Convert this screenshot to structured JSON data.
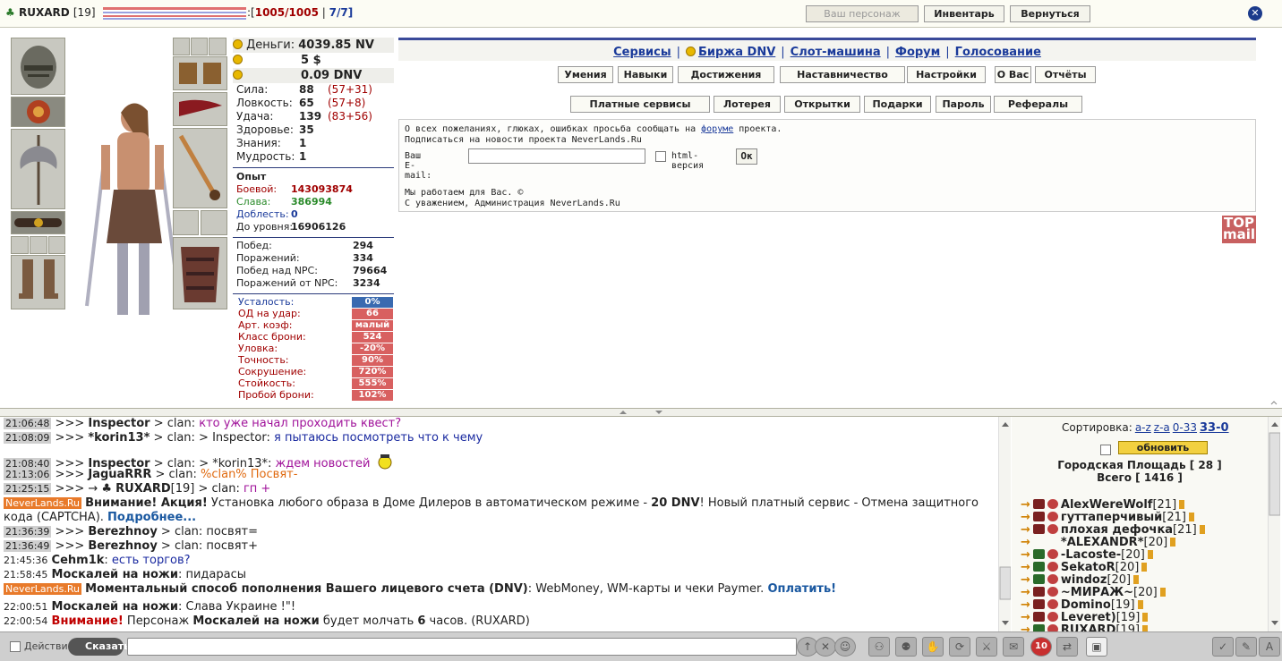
{
  "header": {
    "nick": "RUXARD",
    "level": "[19]",
    "hp_prefix": ":[",
    "hp": "1005/1005",
    "sep": "|",
    "mana": "7/7]",
    "buttons": [
      {
        "label": "Ваш персонаж",
        "disabled": true
      },
      {
        "label": "Инвентарь",
        "disabled": false
      },
      {
        "label": "Вернуться",
        "disabled": false
      }
    ],
    "close": "✕"
  },
  "money": {
    "label": "Деньги:",
    "nv": "4039.85 NV",
    "usd": "5 $",
    "dnv": "0.09 DNV"
  },
  "stats": [
    {
      "label": "Сила:",
      "value": "88",
      "sub": "(57+31)"
    },
    {
      "label": "Ловкость:",
      "value": "65",
      "sub": "(57+8)"
    },
    {
      "label": "Удача:",
      "value": "139",
      "sub": "(83+56)"
    },
    {
      "label": "Здоровье:",
      "value": "35",
      "sub": ""
    },
    {
      "label": "Знания:",
      "value": "1",
      "sub": ""
    },
    {
      "label": "Мудрость:",
      "value": "1",
      "sub": ""
    }
  ],
  "experience": {
    "title": "Опыт",
    "rows": [
      {
        "label": "Боевой:",
        "value": "143093874",
        "color": "#a00000"
      },
      {
        "label": "Слава:",
        "value": "386994",
        "color": "#2a8a2a"
      },
      {
        "label": "Доблесть:",
        "value": "0",
        "color": "#1a3a9a"
      },
      {
        "label": "До уровня:",
        "value": "16906126",
        "color": "#222222"
      }
    ]
  },
  "wins": [
    {
      "label": "Побед:",
      "value": "294"
    },
    {
      "label": "Поражений:",
      "value": "334"
    },
    {
      "label": "Побед над NPC:",
      "value": "79664"
    },
    {
      "label": "Поражений от NPC:",
      "value": "3234"
    }
  ],
  "mods": [
    {
      "label": "Усталость:",
      "value": "0%",
      "blue": true
    },
    {
      "label": "ОД на удар:",
      "value": "66"
    },
    {
      "label": "Арт. коэф:",
      "value": "малый"
    },
    {
      "label": "Класс брони:",
      "value": "524"
    },
    {
      "label": "Уловка:",
      "value": "-20%"
    },
    {
      "label": "Точность:",
      "value": "90%"
    },
    {
      "label": "Сокрушение:",
      "value": "720%"
    },
    {
      "label": "Стойкость:",
      "value": "555%"
    },
    {
      "label": "Пробой брони:",
      "value": "102%"
    }
  ],
  "links": [
    {
      "label": "Сервисы"
    },
    {
      "label": "Биржа DNV"
    },
    {
      "label": "Слот-машина"
    },
    {
      "label": "Форум"
    },
    {
      "label": "Голосование"
    }
  ],
  "link_sep": "|",
  "row1": [
    "Умения",
    "Навыки",
    "Достижения",
    "Наставничество",
    "Настройки",
    "О Вас",
    "Отчёты"
  ],
  "row2": [
    "Платные сервисы",
    "Лотерея",
    "Открытки",
    "Подарки",
    "Пароль",
    "Рефералы"
  ],
  "info": {
    "line1_pre": "О всех пожеланиях, глюках, ошибках просьба сообщать на ",
    "line1_link": "форуме",
    "line1_post": " проекта.",
    "line2": "Подписаться на новости проекта NeverLands.Ru",
    "email_label": "Ваш E-mail:",
    "html_label": "html-версия",
    "ok": "Ок",
    "footer1": "Мы работаем для Вас. ©",
    "footer2": "С уважением, Администрация NeverLands.Ru"
  },
  "topmail": {
    "line1": "TOP",
    "line2": "mail"
  },
  "chat": [
    {
      "ts": "21:06:48",
      "parts": [
        [
          ">>> ",
          ""
        ],
        [
          "Inspector",
          "b"
        ],
        [
          " > clan: ",
          ""
        ],
        [
          "кто уже начал проходить квест?",
          "pink"
        ]
      ]
    },
    {
      "ts": "21:08:09",
      "parts": [
        [
          ">>> ",
          ""
        ],
        [
          "*korin13*",
          "b"
        ],
        [
          " > clan: > Inspector: ",
          ""
        ],
        [
          "я пытаюсь посмотреть что к чему",
          "blue"
        ]
      ]
    },
    {
      "ts": "21:08:40",
      "parts": [
        [
          ">>> ",
          ""
        ],
        [
          "Inspector",
          "b"
        ],
        [
          " > clan: > *korin13*: ",
          ""
        ],
        [
          "ждем новостей",
          "pink"
        ]
      ]
    },
    {
      "ts": "21:13:06",
      "parts": [
        [
          ">>> ",
          ""
        ],
        [
          "JaguaRRR",
          "b"
        ],
        [
          " > clan: ",
          ""
        ],
        [
          "%clan% Посвят-",
          "orange"
        ]
      ]
    },
    {
      "ts": "21:25:15",
      "parts": [
        [
          ">>> → ♣ ",
          ""
        ],
        [
          "RUXARD",
          "b"
        ],
        [
          "[19] ",
          ""
        ],
        [
          " > clan: ",
          ""
        ],
        [
          "гп +",
          "pink"
        ]
      ]
    },
    {
      "nl": "NeverLands.Ru",
      "parts": [
        [
          "Внимание! Акция!",
          "b"
        ],
        [
          " Установка любого образа в Доме Дилеров в автоматическом режиме - ",
          ""
        ],
        [
          "20 DNV",
          "b"
        ],
        [
          "! Новый платный сервис - Отмена защитного кода (CAPTCHA). ",
          ""
        ],
        [
          "Подробнее...",
          "lnk"
        ]
      ]
    },
    {
      "ts": "21:36:39",
      "parts": [
        [
          ">>> ",
          ""
        ],
        [
          "Berezhnoy",
          "b"
        ],
        [
          " > clan: посвят=",
          ""
        ]
      ]
    },
    {
      "ts": "21:36:49",
      "parts": [
        [
          ">>> ",
          ""
        ],
        [
          "Berezhnoy",
          "b"
        ],
        [
          " > clan: посвят+",
          ""
        ]
      ]
    },
    {
      "ts_plain": "21:45:36",
      "parts": [
        [
          "Cehm1k",
          "b"
        ],
        [
          ": ",
          ""
        ],
        [
          "есть торгов?",
          "blue"
        ]
      ]
    },
    {
      "ts_plain": "21:58:45",
      "parts": [
        [
          "Москалей на ножи",
          "b"
        ],
        [
          ": пидарасы",
          ""
        ]
      ]
    },
    {
      "nl": "NeverLands.Ru",
      "parts": [
        [
          "Моментальный способ пополнения Вашего лицевого счета (DNV)",
          "b"
        ],
        [
          ": ",
          ""
        ],
        [
          "WebMoney, WM-карты и чеки Paymer. ",
          ""
        ],
        [
          "Оплатить!",
          "lnk"
        ]
      ]
    },
    {
      "ts_plain": "22:00:51",
      "parts": [
        [
          "Москалей на ножи",
          "b"
        ],
        [
          ": Слава Украине !\"!",
          ""
        ]
      ]
    },
    {
      "ts_plain": "22:00:54",
      "parts": [
        [
          "Внимание!",
          "b red"
        ],
        [
          " Персонаж ",
          ""
        ],
        [
          "Москалей на ножи",
          "b"
        ],
        [
          " будет молчать ",
          ""
        ],
        [
          "6",
          "b"
        ],
        [
          " часов. (RUXARD)",
          ""
        ]
      ]
    }
  ],
  "online": {
    "sort_label": "Сортировка:",
    "sort_opts": [
      "a-z",
      "z-a",
      "0-33",
      "33-0"
    ],
    "refresh": "обновить",
    "location": "Городская Площадь [ 28 ]",
    "total": "Всего [ 1416 ]",
    "users": [
      {
        "name": "AlexWereWolf",
        "lvl": "[21]",
        "clan": "red"
      },
      {
        "name": "гуттаперчивый",
        "lvl": "[21]",
        "clan": "red"
      },
      {
        "name": "плохая дефочка",
        "lvl": "[21]",
        "clan": "red"
      },
      {
        "name": "*ALEXANDR*",
        "lvl": "[20]",
        "clan": "none"
      },
      {
        "name": "-Lacoste-",
        "lvl": "[20]",
        "clan": "green"
      },
      {
        "name": "SekatoR",
        "lvl": "[20]",
        "clan": "green"
      },
      {
        "name": "windoz",
        "lvl": "[20]",
        "clan": "green"
      },
      {
        "name": "~МИРАЖ~",
        "lvl": "[20]",
        "clan": "red"
      },
      {
        "name": "Domino",
        "lvl": "[19]",
        "clan": "red"
      },
      {
        "name": "Leveret)",
        "lvl": "[19]",
        "clan": "red"
      },
      {
        "name": "RUXARD",
        "lvl": "[19]",
        "clan": "green"
      }
    ]
  },
  "bottom": {
    "action": "Действие",
    "say": "Сказать:",
    "badge": "10"
  }
}
